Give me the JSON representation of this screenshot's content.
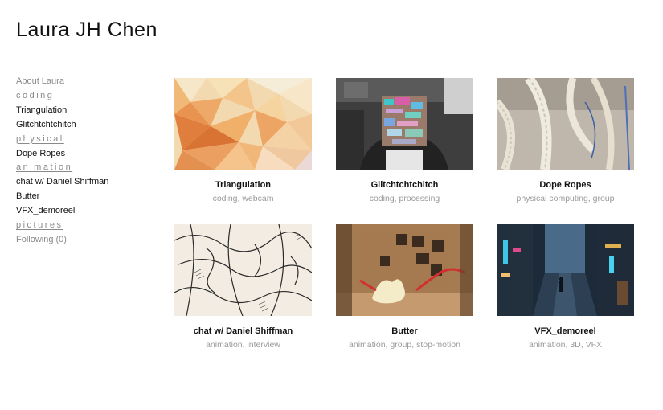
{
  "site": {
    "title": "Laura JH Chen"
  },
  "sidebar": {
    "about": "About Laura",
    "categories": {
      "coding": "coding",
      "physical": "physical",
      "animation": "animation",
      "pictures": "pictures"
    },
    "items": {
      "triangulation": "Triangulation",
      "glitch": "Glitchtchtchitch",
      "dope_ropes": "Dope Ropes",
      "chat": "chat w/ Daniel Shiffman",
      "butter": "Butter",
      "vfx": "VFX_demoreel"
    },
    "following": "Following  (0)"
  },
  "projects": [
    {
      "title": "Triangulation",
      "tags": "coding, webcam",
      "image": "low-poly-triangulated-portrait"
    },
    {
      "title": "Glitchtchtchitch",
      "tags": "coding, processing",
      "image": "glitched-webcam-portrait"
    },
    {
      "title": "Dope Ropes",
      "tags": "physical computing, group",
      "image": "braided-rope-installation"
    },
    {
      "title": "chat w/ Daniel Shiffman",
      "tags": "animation, interview",
      "image": "ink-sketch-illustration"
    },
    {
      "title": "Butter",
      "tags": "animation, group, stop-motion",
      "image": "stop-motion-butter-set"
    },
    {
      "title": "VFX_demoreel",
      "tags": "animation, 3D, VFX",
      "image": "neon-city-alley-render"
    }
  ],
  "colors": {
    "text": "#111111",
    "muted": "#8a8a8a",
    "tags": "#9a9a9a",
    "background": "#ffffff"
  }
}
